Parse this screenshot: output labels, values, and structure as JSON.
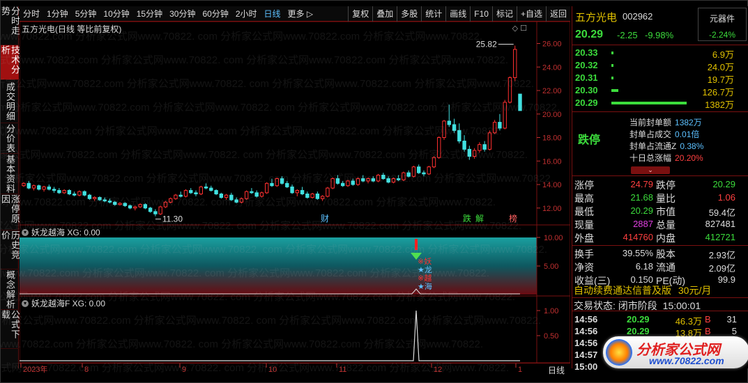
{
  "sidebar": {
    "items": [
      {
        "label": "分时走势",
        "active": false
      },
      {
        "label": "技术分析",
        "active": true
      },
      {
        "label": "成交明细",
        "active": false
      },
      {
        "label": "分价表",
        "active": false
      },
      {
        "label": "基本资料",
        "active": false
      },
      {
        "label": "涨停原因",
        "active": false
      },
      {
        "label": "历史竞价",
        "active": false
      },
      {
        "label": "概念解析",
        "active": false
      },
      {
        "label": "公式下载",
        "active": false
      }
    ]
  },
  "toolbar": {
    "periods": [
      "分时",
      "1分钟",
      "5分钟",
      "10分钟",
      "15分钟",
      "30分钟",
      "60分钟",
      "2小时",
      "日线",
      "更多 ▷"
    ],
    "active_period": "日线",
    "right_buttons": [
      "复权",
      "叠加",
      "多股",
      "统计",
      "画线",
      "F10",
      "标记",
      "+自选",
      "返回"
    ]
  },
  "main_chart": {
    "title": "五方光电(日线 等比前复权)",
    "y_ticks": [
      "26.00",
      "24.00",
      "22.00",
      "20.00",
      "18.00",
      "16.00",
      "14.00",
      "12.00"
    ],
    "high_label": "25.82",
    "low_label": "11.30",
    "markers": [
      {
        "text": "财",
        "color": "#5cc0ff"
      },
      {
        "text": "跌",
        "color": "#3cdc3c"
      },
      {
        "text": "解",
        "color": "#3cdc3c"
      },
      {
        "text": "榜",
        "color": "#ff6060"
      }
    ]
  },
  "sub1": {
    "title": "妖龙越海 XG: 0.00",
    "y_ticks": [
      "10.00",
      "5.00"
    ],
    "signal_chars": [
      "※妖",
      "★龙",
      "※越",
      "★海"
    ]
  },
  "sub2": {
    "title": "妖龙越海F XG: 0.00",
    "y_ticks": [
      "1.00",
      "0.50"
    ]
  },
  "date_axis": {
    "labels": [
      "2023年",
      "8",
      "9",
      "10",
      "11",
      "12",
      "1"
    ],
    "period": "日线"
  },
  "quote": {
    "name": "五方光电",
    "code": "002962",
    "tag_label": "元器件",
    "tag_change": "-2.24%",
    "price": "20.29",
    "change": "-2.25",
    "pct": "-9.98%",
    "book": [
      {
        "price": "20.33",
        "vol": "6.9万"
      },
      {
        "price": "20.32",
        "vol": "24.0万"
      },
      {
        "price": "20.31",
        "vol": "19.7万"
      },
      {
        "price": "20.30",
        "vol": "126.7万"
      },
      {
        "price": "20.29",
        "vol": "1382万"
      }
    ],
    "limit_status": "跌停",
    "limit_info": [
      {
        "label": "当前封单额",
        "value": "1382万"
      },
      {
        "label": "封单占成交",
        "value": "0.01倍"
      },
      {
        "label": "封单占流通Z",
        "value": "0.38%"
      },
      {
        "label": "十日总涨幅",
        "value": "20.20%"
      }
    ],
    "stats": [
      {
        "l1": "涨停",
        "v1": "24.79",
        "c1": "r",
        "l2": "跌停",
        "v2": "20.29",
        "c2": "g"
      },
      {
        "l1": "最高",
        "v1": "21.68",
        "c1": "g",
        "l2": "量比",
        "v2": "1.06",
        "c2": "r"
      },
      {
        "l1": "最低",
        "v1": "20.29",
        "c1": "g",
        "l2": "市值",
        "v2": "59.4亿",
        "c2": "w"
      },
      {
        "l1": "现量",
        "v1": "2887",
        "c1": "m",
        "l2": "总量",
        "v2": "827481",
        "c2": "w"
      },
      {
        "l1": "外盘",
        "v1": "414760",
        "c1": "r",
        "l2": "内盘",
        "v2": "412721",
        "c2": "g"
      },
      {
        "l1": "换手",
        "v1": "39.55%",
        "c1": "w",
        "l2": "股本",
        "v2": "2.93亿",
        "c2": "w"
      },
      {
        "l1": "净资",
        "v1": "6.18",
        "c1": "w",
        "l2": "流通",
        "v2": "2.09亿",
        "c2": "w"
      },
      {
        "l1": "收益(三)",
        "v1": "0.150",
        "c1": "w",
        "l2": "PE(动)",
        "v2": "99.9",
        "c2": "w"
      }
    ],
    "ad_text": "自动续费通达信普及版",
    "ad_price": "30元/月",
    "status_label": "交易状态:",
    "status_value": "闭市阶段",
    "status_time": "15:00:01",
    "trades": [
      {
        "time": "14:56",
        "price": "20.29",
        "vol": "46.3万",
        "side": "B",
        "num": "31"
      },
      {
        "time": "14:56",
        "price": "20.29",
        "vol": "13.8万",
        "side": "B",
        "num": "5"
      },
      {
        "time": "14:56",
        "price": "20.29",
        "vol": "24.1万",
        "side": "B",
        "num": "4"
      },
      {
        "time": "14:57",
        "price": "",
        "vol": "",
        "side": "",
        "num": ""
      },
      {
        "time": "15:00",
        "price": "",
        "vol": "",
        "side": "",
        "num": ""
      }
    ]
  },
  "watermark": {
    "text": "com 分析家公式网www.70822.com 分析家公式网www.70822.",
    "logo_text": "分析家公式网",
    "logo_url": "www.70822.com"
  },
  "chart_data": {
    "type": "candlestick",
    "title": "五方光电(日线 等比前复权)",
    "ylim": [
      10.8,
      26.8
    ],
    "candles": [
      [
        13.9,
        14.2,
        13.8,
        14.1
      ],
      [
        14.1,
        14.3,
        13.6,
        13.7
      ],
      [
        13.7,
        14.0,
        13.5,
        13.9
      ],
      [
        13.9,
        14.0,
        13.5,
        13.6
      ],
      [
        13.6,
        13.9,
        13.4,
        13.8
      ],
      [
        13.8,
        14.0,
        13.5,
        13.6
      ],
      [
        13.6,
        13.8,
        13.3,
        13.5
      ],
      [
        13.5,
        13.7,
        13.2,
        13.3
      ],
      [
        13.3,
        13.6,
        13.2,
        13.5
      ],
      [
        13.5,
        13.6,
        13.1,
        13.2
      ],
      [
        13.2,
        13.4,
        13.0,
        13.1
      ],
      [
        13.1,
        13.5,
        13.0,
        13.4
      ],
      [
        13.4,
        13.5,
        13.0,
        13.1
      ],
      [
        13.1,
        13.2,
        12.7,
        12.8
      ],
      [
        12.8,
        13.0,
        12.6,
        12.9
      ],
      [
        12.9,
        13.0,
        12.6,
        12.7
      ],
      [
        12.7,
        12.9,
        12.5,
        12.6
      ],
      [
        12.6,
        12.8,
        12.4,
        12.5
      ],
      [
        12.5,
        12.6,
        12.2,
        12.3
      ],
      [
        12.3,
        12.5,
        12.2,
        12.4
      ],
      [
        12.4,
        12.5,
        12.1,
        12.2
      ],
      [
        12.2,
        12.3,
        11.9,
        12.0
      ],
      [
        12.0,
        12.2,
        11.8,
        12.1
      ],
      [
        12.1,
        12.4,
        12.0,
        12.3
      ],
      [
        12.3,
        12.4,
        11.9,
        12.0
      ],
      [
        12.0,
        12.1,
        11.6,
        11.7
      ],
      [
        11.7,
        11.9,
        11.3,
        11.5
      ],
      [
        11.5,
        12.2,
        11.4,
        12.1
      ],
      [
        12.1,
        12.6,
        12.0,
        12.5
      ],
      [
        12.5,
        12.9,
        12.4,
        12.8
      ],
      [
        12.8,
        13.2,
        12.7,
        13.1
      ],
      [
        13.1,
        13.4,
        12.9,
        13.0
      ],
      [
        13.0,
        13.6,
        12.9,
        13.5
      ],
      [
        13.5,
        13.7,
        13.2,
        13.3
      ],
      [
        13.3,
        13.5,
        13.0,
        13.2
      ],
      [
        13.2,
        13.9,
        13.1,
        13.8
      ],
      [
        13.8,
        14.1,
        13.6,
        13.7
      ],
      [
        13.7,
        13.9,
        13.4,
        13.5
      ],
      [
        13.5,
        13.6,
        13.1,
        13.2
      ],
      [
        13.2,
        13.3,
        12.8,
        12.9
      ],
      [
        12.9,
        13.2,
        12.7,
        13.1
      ],
      [
        13.1,
        13.3,
        12.6,
        12.7
      ],
      [
        12.7,
        12.9,
        12.4,
        12.5
      ],
      [
        12.5,
        12.9,
        12.4,
        12.8
      ],
      [
        12.8,
        13.5,
        12.7,
        13.4
      ],
      [
        13.4,
        13.7,
        13.2,
        13.3
      ],
      [
        13.3,
        13.5,
        12.9,
        13.0
      ],
      [
        13.0,
        13.4,
        12.9,
        13.3
      ],
      [
        13.3,
        14.2,
        13.2,
        14.1
      ],
      [
        14.1,
        14.5,
        13.8,
        13.9
      ],
      [
        13.9,
        14.6,
        13.8,
        14.5
      ],
      [
        14.5,
        14.7,
        14.0,
        14.1
      ],
      [
        14.1,
        14.3,
        13.7,
        13.8
      ],
      [
        13.8,
        14.0,
        13.2,
        13.3
      ],
      [
        13.3,
        13.6,
        13.0,
        13.5
      ],
      [
        13.5,
        13.8,
        13.1,
        13.2
      ],
      [
        13.2,
        13.4,
        12.8,
        12.9
      ],
      [
        12.9,
        13.3,
        12.8,
        13.2
      ],
      [
        13.2,
        13.4,
        12.7,
        12.8
      ],
      [
        12.8,
        13.1,
        12.6,
        13.0
      ],
      [
        13.0,
        13.8,
        12.9,
        13.7
      ],
      [
        13.7,
        14.6,
        13.6,
        14.5
      ],
      [
        14.5,
        14.8,
        14.0,
        14.1
      ],
      [
        14.1,
        14.3,
        13.8,
        13.9
      ],
      [
        13.9,
        14.4,
        13.8,
        14.3
      ],
      [
        14.3,
        14.5,
        13.9,
        14.0
      ],
      [
        14.0,
        14.6,
        13.9,
        14.5
      ],
      [
        14.5,
        14.8,
        14.2,
        14.3
      ],
      [
        14.3,
        14.6,
        14.1,
        14.5
      ],
      [
        14.5,
        14.7,
        14.2,
        14.3
      ],
      [
        14.3,
        14.9,
        14.2,
        14.8
      ],
      [
        14.8,
        15.0,
        14.4,
        14.5
      ],
      [
        14.5,
        14.7,
        14.1,
        14.2
      ],
      [
        14.2,
        14.6,
        14.1,
        14.5
      ],
      [
        14.5,
        14.8,
        14.3,
        14.4
      ],
      [
        14.4,
        15.1,
        14.3,
        15.0
      ],
      [
        15.0,
        15.2,
        14.6,
        14.7
      ],
      [
        14.7,
        15.6,
        14.6,
        15.5
      ],
      [
        15.5,
        15.7,
        14.9,
        15.0
      ],
      [
        15.0,
        15.2,
        14.7,
        14.9
      ],
      [
        14.9,
        15.6,
        14.8,
        15.5
      ],
      [
        15.5,
        16.4,
        15.4,
        16.3
      ],
      [
        16.3,
        18.1,
        16.2,
        18.0
      ],
      [
        18.0,
        19.5,
        17.8,
        19.4
      ],
      [
        19.4,
        20.8,
        18.9,
        19.1
      ],
      [
        19.1,
        19.6,
        18.4,
        18.6
      ],
      [
        18.6,
        19.2,
        17.5,
        17.7
      ],
      [
        17.7,
        18.2,
        16.8,
        17.0
      ],
      [
        17.0,
        17.3,
        16.1,
        16.4
      ],
      [
        16.4,
        17.1,
        16.2,
        16.9
      ],
      [
        16.9,
        17.6,
        16.7,
        17.4
      ],
      [
        17.4,
        17.7,
        16.8,
        17.0
      ],
      [
        17.0,
        18.6,
        16.9,
        18.4
      ],
      [
        18.4,
        19.5,
        18.3,
        19.3
      ],
      [
        19.3,
        20.0,
        18.6,
        18.8
      ],
      [
        18.8,
        21.2,
        18.7,
        21.0
      ],
      [
        21.0,
        23.2,
        20.9,
        23.1
      ],
      [
        23.1,
        25.82,
        22.8,
        25.5
      ],
      [
        21.7,
        21.7,
        20.29,
        20.29
      ]
    ],
    "markers": [
      "财",
      "跌",
      "解",
      "榜"
    ],
    "sub_charts": [
      {
        "name": "妖龙越海",
        "ylim": [
          0,
          10
        ]
      },
      {
        "name": "妖龙越海F",
        "ylim": [
          0,
          1
        ],
        "spike": 1.0
      }
    ]
  }
}
